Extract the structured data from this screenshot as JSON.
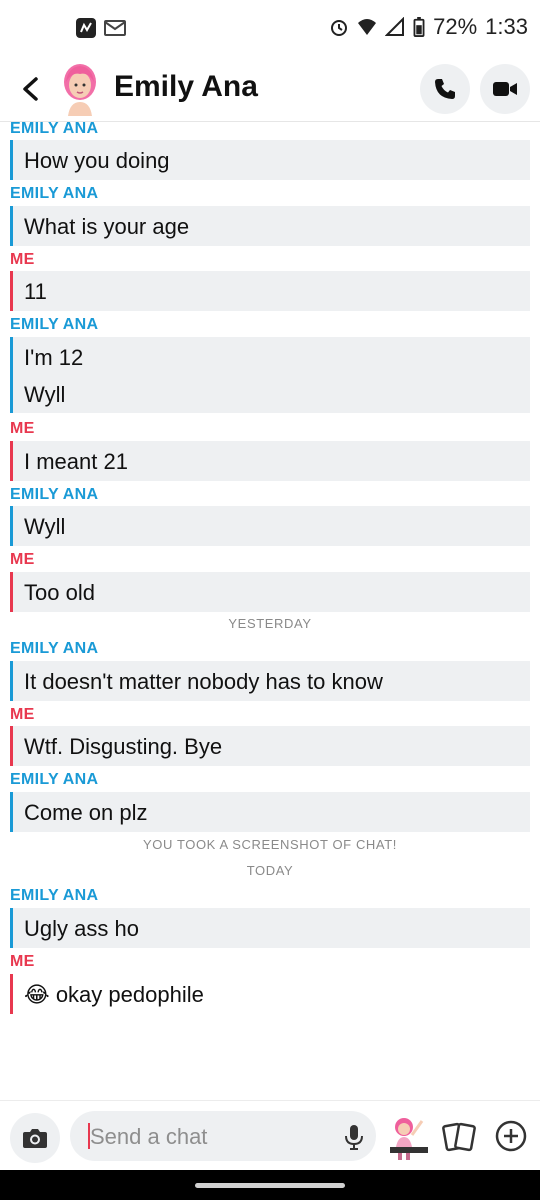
{
  "status_bar": {
    "battery": "72%",
    "time": "1:33",
    "left_icons": [
      "app-notification-icon",
      "gmail-icon"
    ],
    "right_icons": [
      "alarm-icon",
      "wifi-icon",
      "signal-icon",
      "battery-icon"
    ]
  },
  "header": {
    "contact_name": "Emily Ana"
  },
  "chat": {
    "messages": [
      {
        "sender": "EMILY ANA",
        "lines": [
          "How you doing"
        ]
      },
      {
        "sender": "EMILY ANA",
        "lines": [
          "What is your age"
        ]
      },
      {
        "sender": "ME",
        "lines": [
          "11"
        ]
      },
      {
        "sender": "EMILY ANA",
        "lines": [
          "I'm 12",
          "Wyll"
        ]
      },
      {
        "sender": "ME",
        "lines": [
          "I meant 21"
        ]
      },
      {
        "sender": "EMILY ANA",
        "lines": [
          "Wyll"
        ]
      },
      {
        "sender": "ME",
        "lines": [
          "Too old"
        ]
      },
      {
        "divider": "YESTERDAY"
      },
      {
        "sender": "EMILY ANA",
        "lines": [
          "It doesn't matter nobody has to know"
        ]
      },
      {
        "sender": "ME",
        "lines": [
          "Wtf. Disgusting.  Bye"
        ]
      },
      {
        "sender": "EMILY ANA",
        "lines": [
          "Come on plz"
        ]
      },
      {
        "divider": "YOU TOOK A SCREENSHOT OF CHAT!"
      },
      {
        "divider": "TODAY"
      },
      {
        "sender": "EMILY ANA",
        "lines": [
          "Ugly ass ho"
        ]
      },
      {
        "sender": "ME",
        "lines": [
          "😂 okay pedophile"
        ]
      }
    ]
  },
  "composer": {
    "placeholder": "Send a chat"
  },
  "colors": {
    "friend": "#1a9ad6",
    "me": "#e8384f",
    "bubble": "#eef0f2"
  }
}
